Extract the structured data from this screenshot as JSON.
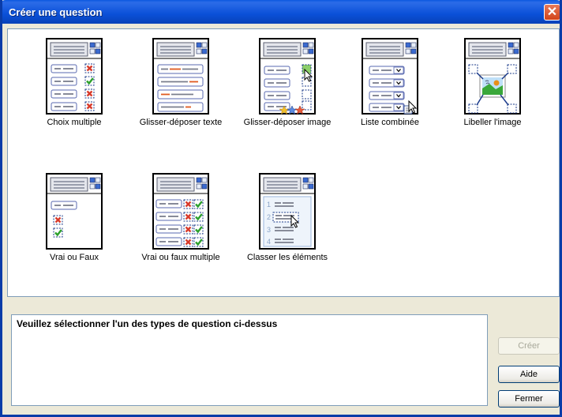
{
  "window": {
    "title": "Créer une question",
    "close_label": "✕"
  },
  "question_types": [
    {
      "label": "Choix multiple"
    },
    {
      "label": "Glisser-déposer texte"
    },
    {
      "label": "Glisser-déposer image"
    },
    {
      "label": "Liste combinée"
    },
    {
      "label": "Libeller l'image"
    },
    {
      "label": "Vrai ou Faux"
    },
    {
      "label": "Vrai ou faux multiple"
    },
    {
      "label": "Classer les éléments"
    }
  ],
  "rank_numbers": [
    "1",
    "2",
    "3",
    "4"
  ],
  "message": "Veuillez sélectionner l'un des types de question ci-dessus",
  "buttons": {
    "create": "Créer",
    "help": "Aide",
    "close": "Fermer"
  },
  "colors": {
    "title_bar": "#0a50d8",
    "accent_red": "#d83a2a",
    "accent_green": "#2ca02c",
    "dashed_blue": "#1a3a8a"
  }
}
